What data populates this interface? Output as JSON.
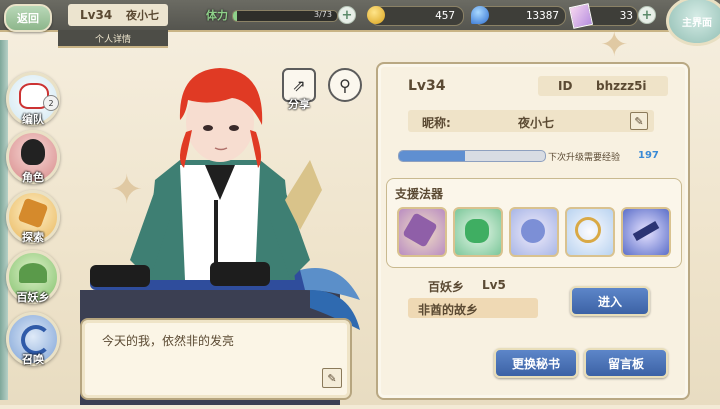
{
  "topbar": {
    "back_label": "返回",
    "level": "Lv34",
    "nickname": "夜小七",
    "stamina_label": "体力",
    "stamina_value": "3/73",
    "gold": "457",
    "gems": "13387",
    "tickets": "33",
    "main_label": "主界面"
  },
  "detail_tab": "个人详情",
  "sidebar": {
    "items": [
      {
        "label": "编队",
        "badge": "2"
      },
      {
        "label": "角色"
      },
      {
        "label": "探索"
      },
      {
        "label": "百妖乡"
      },
      {
        "label": "召唤"
      }
    ]
  },
  "character": {
    "share_label": "分享"
  },
  "dialog": {
    "text": "今天的我，依然非的发亮"
  },
  "panel": {
    "level": "Lv34",
    "id_label": "ID",
    "id_value": "bhzzz5i",
    "nickname_label": "昵称:",
    "nickname_value": "夜小七",
    "exp_label": "下次升级需要经验",
    "exp_value": "197",
    "exp_progress": 0.45,
    "support_title": "支援法器",
    "village_label": "百妖乡",
    "village_level": "Lv5",
    "village_name": "非酋的故乡",
    "enter_label": "进入",
    "change_secretary_label": "更换秘书",
    "message_board_label": "留言板"
  },
  "colors": {
    "accent_blue": "#4a72b8",
    "exp_fill": "#5f8fd1",
    "hair": "#e03a24"
  }
}
